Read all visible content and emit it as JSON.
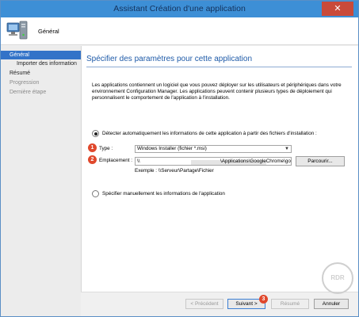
{
  "window": {
    "title": "Assistant Création d'une application",
    "close_glyph": "✕"
  },
  "header": {
    "icon": "computer-icon",
    "label": "Général"
  },
  "nav": {
    "items": [
      {
        "label": "Général",
        "state": "active"
      },
      {
        "label": "Importer des information",
        "state": "normal"
      },
      {
        "label": "Résumé",
        "state": "normal"
      },
      {
        "label": "Progression",
        "state": "disabled"
      },
      {
        "label": "Dernière étape",
        "state": "disabled"
      }
    ]
  },
  "main": {
    "heading": "Spécifier des paramètres pour cette application",
    "description": "Les applications contiennent un logiciel que vous pouvez déployer sur les utilisateurs et périphériques dans votre environnement Configuration Manager. Les applications peuvent contenir plusieurs types de déploiement qui personnalisent le comportement de l'application à l'installation.",
    "auto_detect_label": "Détecter automatiquement les informations de cette application à partir des fichiers d'installation :",
    "auto_detect_checked": true,
    "type_label": "Type :",
    "type_value": "Windows Installer (fichier *.msi)",
    "location_label": "Emplacement :",
    "location_prefix": "\\\\",
    "location_value": "\\Applications\\GoogleChrome\\googlechrome",
    "browse_label": "Parcourir...",
    "example_text": "Exemple : \\\\Serveur\\Partage\\Fichier",
    "manual_label": "Spécifier manuellement les informations de l'application",
    "manual_checked": false
  },
  "badges": {
    "one": "1",
    "two": "2",
    "three": "3"
  },
  "footer": {
    "previous_label": "< Précédent",
    "next_label": "Suivant >",
    "summary_label": "Résumé",
    "cancel_label": "Annuler"
  },
  "watermark": "RDR",
  "colors": {
    "titlebar": "#3d8fd6",
    "accent": "#1e5aa8",
    "nav_active": "#3373c8",
    "badge": "#e0482c"
  }
}
